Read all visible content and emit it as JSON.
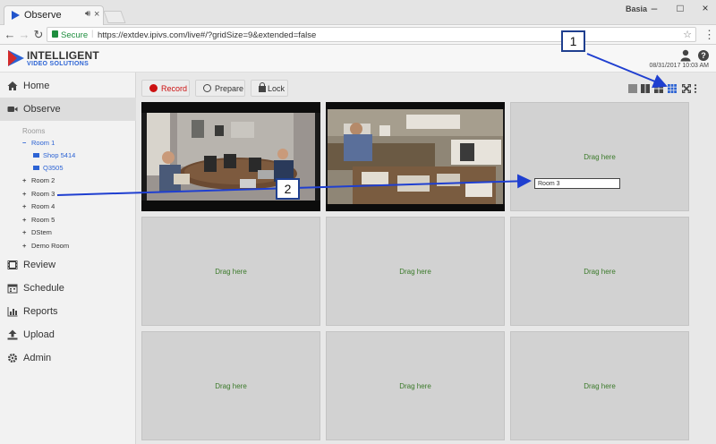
{
  "browser": {
    "tab_title": "Observe",
    "window_user": "Basia",
    "secure_label": "Secure",
    "url": "https://extdev.ipivs.com/live#/?gridSize=9&extended=false"
  },
  "header": {
    "logo_line1": "INTELLIGENT",
    "logo_line2": "VIDEO SOLUTIONS",
    "datetime": "08/31/2017 10:03 AM"
  },
  "sidebar": {
    "items": [
      {
        "label": "Home",
        "icon": "home-icon"
      },
      {
        "label": "Observe",
        "icon": "video-camera-icon"
      },
      {
        "label": "Review",
        "icon": "film-icon"
      },
      {
        "label": "Schedule",
        "icon": "calendar-icon"
      },
      {
        "label": "Reports",
        "icon": "bar-chart-icon"
      },
      {
        "label": "Upload",
        "icon": "upload-icon"
      },
      {
        "label": "Admin",
        "icon": "gear-icon"
      }
    ],
    "rooms_label": "Rooms",
    "rooms": [
      {
        "label": "Room 1",
        "sign": "−"
      },
      {
        "label": "Shop 5414"
      },
      {
        "label": "Q3505"
      },
      {
        "label": "Room 2",
        "sign": "+"
      },
      {
        "label": "Room 3",
        "sign": "+"
      },
      {
        "label": "Room 4",
        "sign": "+"
      },
      {
        "label": "Room 5",
        "sign": "+"
      },
      {
        "label": "DStem",
        "sign": "+"
      },
      {
        "label": "Demo Room",
        "sign": "+"
      }
    ]
  },
  "toolbar": {
    "record_label": "Record",
    "prepare_label": "Prepare",
    "lock_label": "Lock"
  },
  "grid": {
    "drag_label": "Drag here",
    "drop_input_value": "Room 3"
  },
  "annotations": {
    "callout_1": "1",
    "callout_2": "2"
  },
  "colors": {
    "accent_blue": "#2c63d4",
    "record_red": "#cc1111",
    "drag_text_green": "#3b7a2a",
    "annotation_blue": "#1f3fd0"
  }
}
